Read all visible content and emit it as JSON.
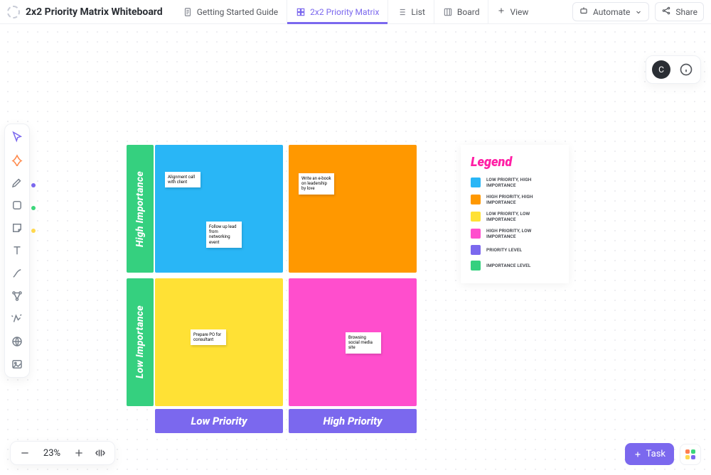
{
  "header": {
    "title": "2x2 Priority Matrix Whiteboard",
    "tabs": [
      {
        "label": "Getting Started Guide"
      },
      {
        "label": "2x2 Priority Matrix"
      },
      {
        "label": "List"
      },
      {
        "label": "Board"
      }
    ],
    "add_view": "View",
    "automate": "Automate",
    "share": "Share",
    "avatar_initial": "C"
  },
  "zoom": {
    "value": "23%"
  },
  "task_button": "Task",
  "matrix": {
    "row_labels": [
      "High Importance",
      "Low Importance"
    ],
    "col_labels": [
      "Low Priority",
      "High Priority"
    ],
    "notes": {
      "tl1": "Alignment call with client",
      "tl2": "Follow up lead from networking event",
      "tr1": "Write an e-book on leadership by love",
      "bl1": "Prepare PO for consultant",
      "br1": "Browsing social media site"
    }
  },
  "legend": {
    "title": "Legend",
    "items": [
      {
        "label": "LOW PRIORITY, HIGH IMPORTANCE",
        "color": "#29b6f6"
      },
      {
        "label": "HIGH PRIORITY, HIGH IMPORTANCE",
        "color": "#ff9800"
      },
      {
        "label": "LOW PRIORITY, LOW IMPORTANCE",
        "color": "#ffe135"
      },
      {
        "label": "HIGH PRIORITY, LOW IMPORTANCE",
        "color": "#ff4ecd"
      },
      {
        "label": "PRIORITY LEVEL",
        "color": "#7b68ee"
      },
      {
        "label": "IMPORTANCE LEVEL",
        "color": "#35d07f"
      }
    ]
  }
}
